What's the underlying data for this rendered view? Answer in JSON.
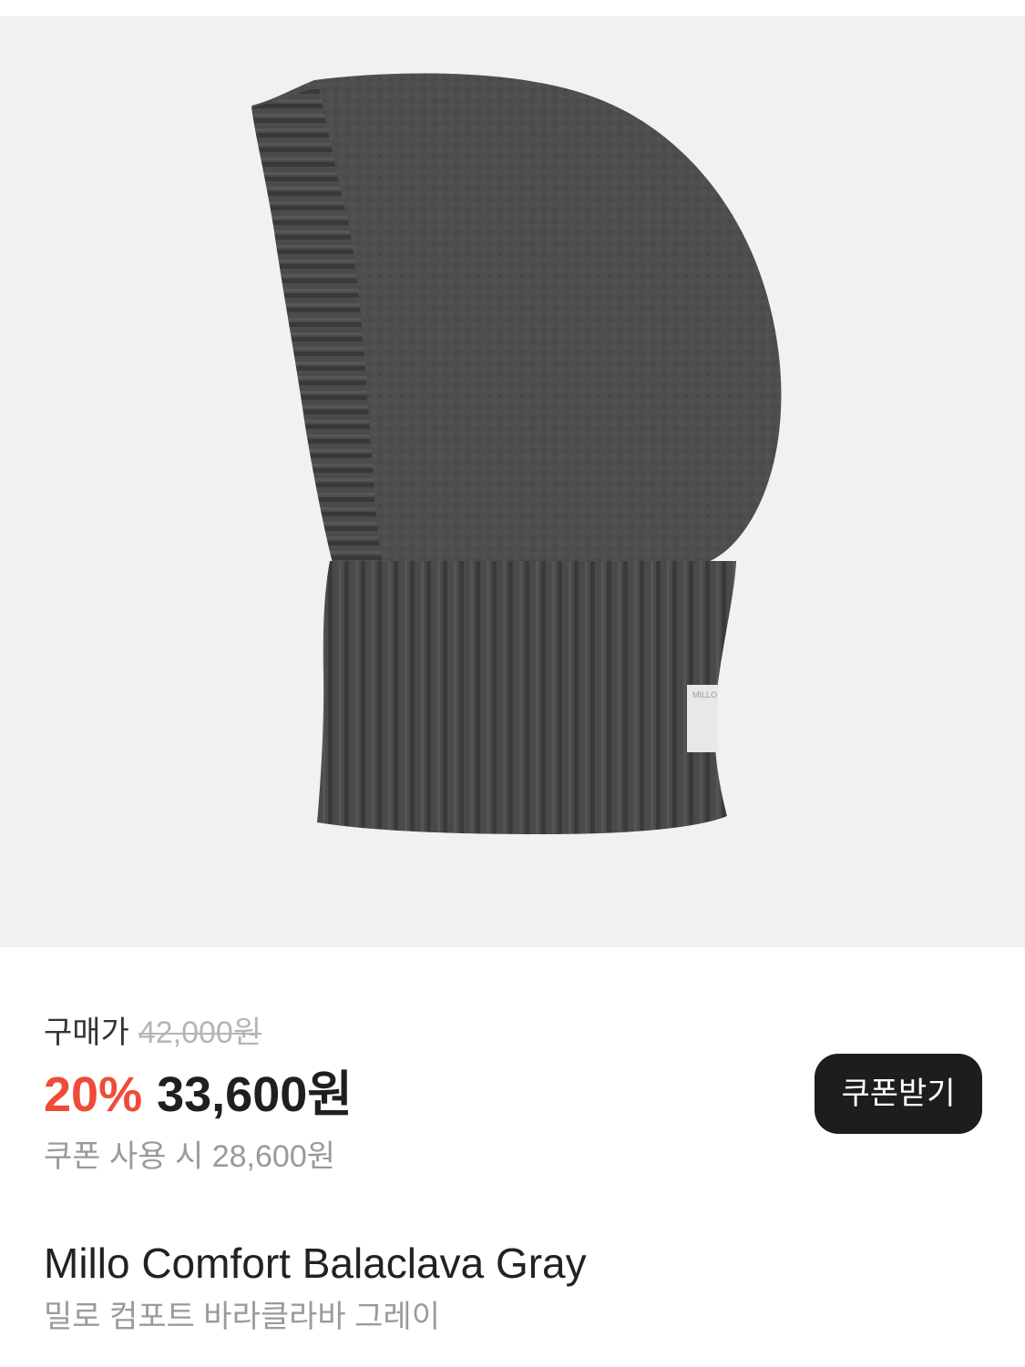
{
  "product_image": {
    "description_icon": "balaclava-image",
    "tag_text": "MILLO"
  },
  "price": {
    "purchase_label": "구매가",
    "original_price": "42,000원",
    "discount_rate": "20%",
    "sale_price": "33,600원",
    "coupon_price": "쿠폰 사용 시 28,600원",
    "coupon_button_label": "쿠폰받기",
    "accent_color": "#ef4b37"
  },
  "product": {
    "name_en": "Millo Comfort Balaclava Gray",
    "name_ko": "밀로 컴포트 바라클라바 그레이"
  }
}
